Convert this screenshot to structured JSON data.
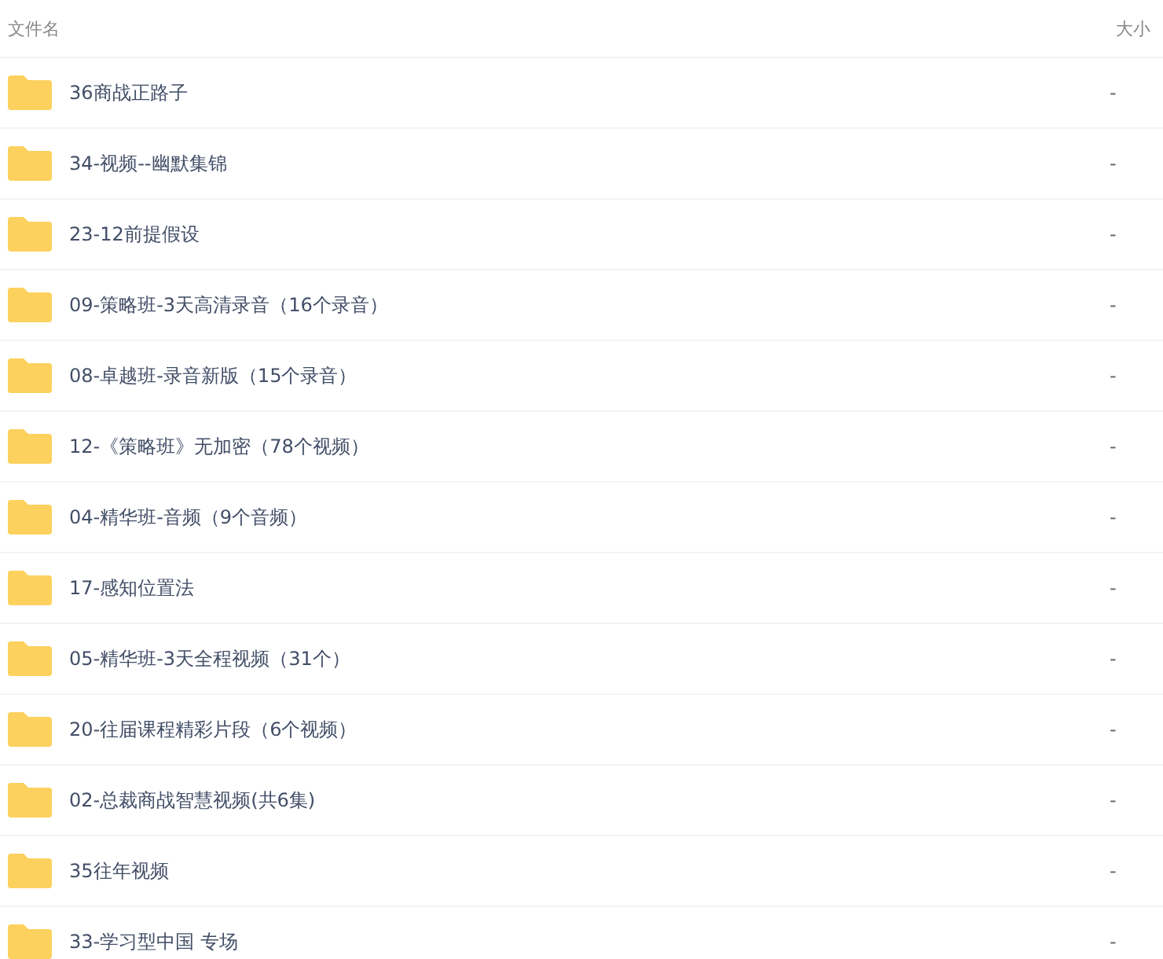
{
  "columns": [
    "文件名",
    "大小"
  ],
  "rows": [
    {
      "name": "36商战正路子",
      "size": "-"
    },
    {
      "name": "34-视频--幽默集锦",
      "size": "-"
    },
    {
      "name": "23-12前提假设",
      "size": "-"
    },
    {
      "name": "09-策略班-3天高清录音（16个录音）",
      "size": "-"
    },
    {
      "name": "08-卓越班-录音新版（15个录音）",
      "size": "-"
    },
    {
      "name": "12-《策略班》无加密（78个视频）",
      "size": "-"
    },
    {
      "name": "04-精华班-音频（9个音频）",
      "size": "-"
    },
    {
      "name": "17-感知位置法",
      "size": "-"
    },
    {
      "name": "05-精华班-3天全程视频（31个）",
      "size": "-"
    },
    {
      "name": "20-往届课程精彩片段（6个视频）",
      "size": "-"
    },
    {
      "name": "02-总裁商战智慧视频(共6集)",
      "size": "-"
    },
    {
      "name": "35往年视频",
      "size": "-"
    },
    {
      "name": "33-学习型中国 专场",
      "size": "-"
    }
  ]
}
